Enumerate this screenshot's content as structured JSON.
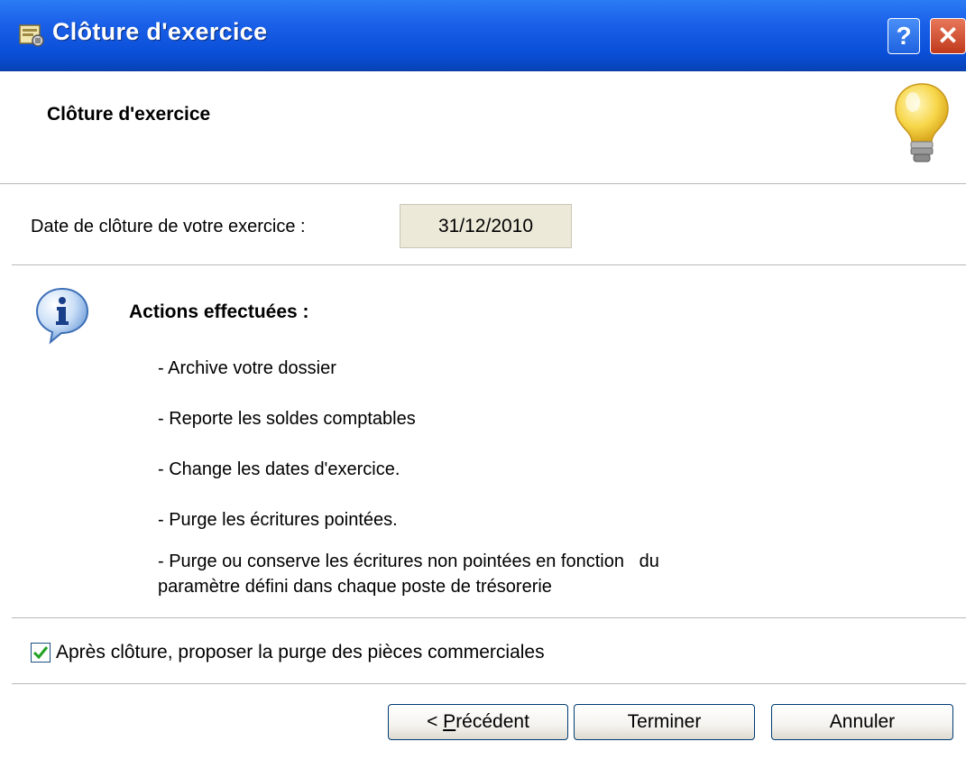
{
  "window": {
    "title": "Clôture d'exercice",
    "help_glyph": "?",
    "close_glyph": "✕"
  },
  "header": {
    "title": "Clôture d'exercice",
    "icon": "lightbulb-icon"
  },
  "date": {
    "label": "Date de clôture de votre exercice :",
    "value": "31/12/2010"
  },
  "actions": {
    "title": "Actions effectuées :",
    "icon": "info-icon",
    "items": [
      "- Archive votre dossier",
      "- Reporte les soldes comptables",
      "- Change les dates d'exercice.",
      "- Purge les écritures pointées.",
      "- Purge ou conserve les écritures non pointées en fonction   du",
      "paramètre défini dans chaque poste de trésorerie"
    ]
  },
  "option": {
    "label": "Après clôture, proposer la purge des pièces commerciales",
    "checked": true
  },
  "buttons": {
    "previous_prefix": "< ",
    "previous_accesskey": "P",
    "previous_rest": "récédent",
    "finish": "Terminer",
    "cancel": "Annuler"
  },
  "colors": {
    "titlebar": "#0a4fd8",
    "date_field_bg": "#ece9d8",
    "button_border": "#003c74"
  }
}
